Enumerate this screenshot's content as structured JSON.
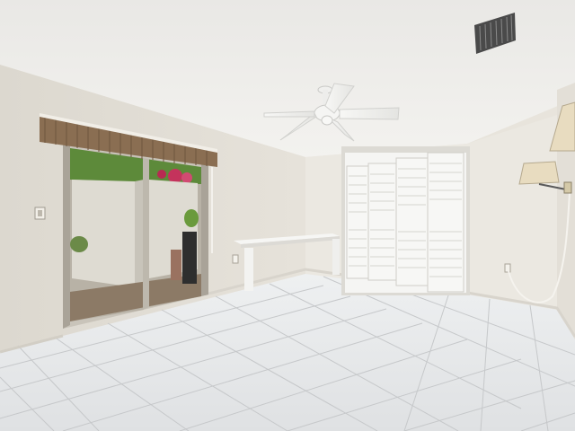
{
  "scene": {
    "description_tags": [
      "ceiling-fan",
      "sliding-glass-door",
      "bifold-closet",
      "floating-desk",
      "tile-floor",
      "wall-lamp",
      "air-vent",
      "window-blind"
    ],
    "colors": {
      "ceiling": "#efeeeb",
      "wall_left": "#e5e1d9",
      "wall_back": "#ebe8e1",
      "wall_right": "#e9e6df",
      "floor": "#e4e6e8",
      "grout": "#c9cbcd",
      "closet": "#f5f5f3",
      "blind": "#8a6e52",
      "lamp_shade": "#e8dcc0",
      "foliage": "#5d8a3a",
      "flowers": "#c4335c",
      "outside_wall": "#dedbd2"
    }
  }
}
